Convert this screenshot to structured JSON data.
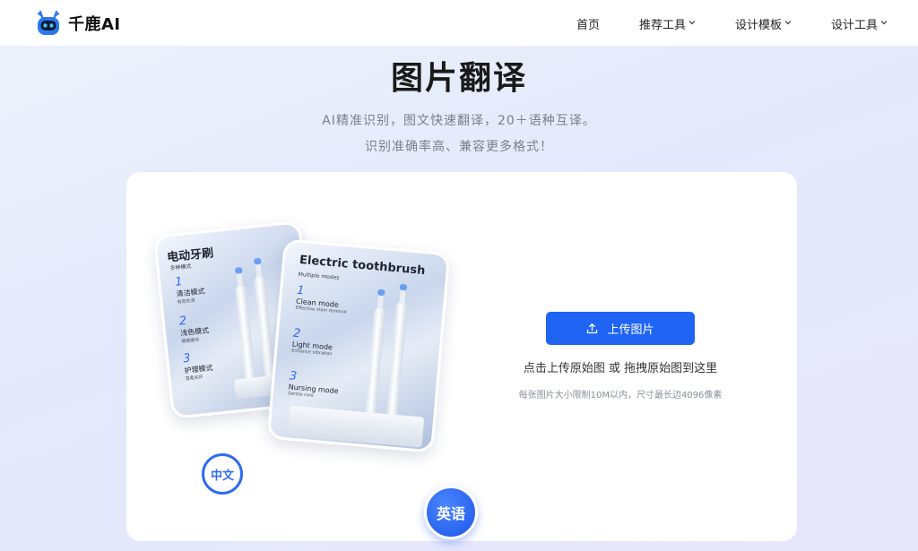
{
  "brand": {
    "name": "千鹿AI",
    "accent_color": "#1f64f2",
    "logo_icon": "robot-deer-icon"
  },
  "nav": {
    "items": [
      {
        "label": "首页",
        "has_dropdown": false
      },
      {
        "label": "推荐工具",
        "has_dropdown": true
      },
      {
        "label": "设计模板",
        "has_dropdown": true
      },
      {
        "label": "设计工具",
        "has_dropdown": true
      }
    ],
    "dropdown_icon": "chevron-down-icon"
  },
  "hero": {
    "title": "图片翻译",
    "subtitle_line1": "AI精准识别，图文快速翻译，20＋语种互译。",
    "subtitle_line2": "识别准确率高、兼容更多格式！"
  },
  "illustration": {
    "back_card": {
      "title": "电动牙刷",
      "subtitle": "多种模式",
      "modes": [
        {
          "num": "1",
          "name": "清洁模式",
          "desc": "有效去渍"
        },
        {
          "num": "2",
          "name": "浅色模式",
          "desc": "增强振动"
        },
        {
          "num": "3",
          "name": "护理模式",
          "desc": "温柔关怀"
        }
      ]
    },
    "front_card": {
      "title": "Electric toothbrush",
      "subtitle": "Multiple modes",
      "modes": [
        {
          "num": "1",
          "name": "Clean mode",
          "desc": "Effective stain removal"
        },
        {
          "num": "2",
          "name": "Light mode",
          "desc": "Enhance vibration"
        },
        {
          "num": "3",
          "name": "Nursing mode",
          "desc": "Gentle care"
        }
      ]
    },
    "badge_source": "中文",
    "badge_target": "英语"
  },
  "upload": {
    "button_label": "上传图片",
    "button_icon": "upload-icon",
    "hint": "点击上传原始图 或 拖拽原始图到这里",
    "limit": "每张图片大小限制10M以内，尺寸最长边4096像素"
  }
}
